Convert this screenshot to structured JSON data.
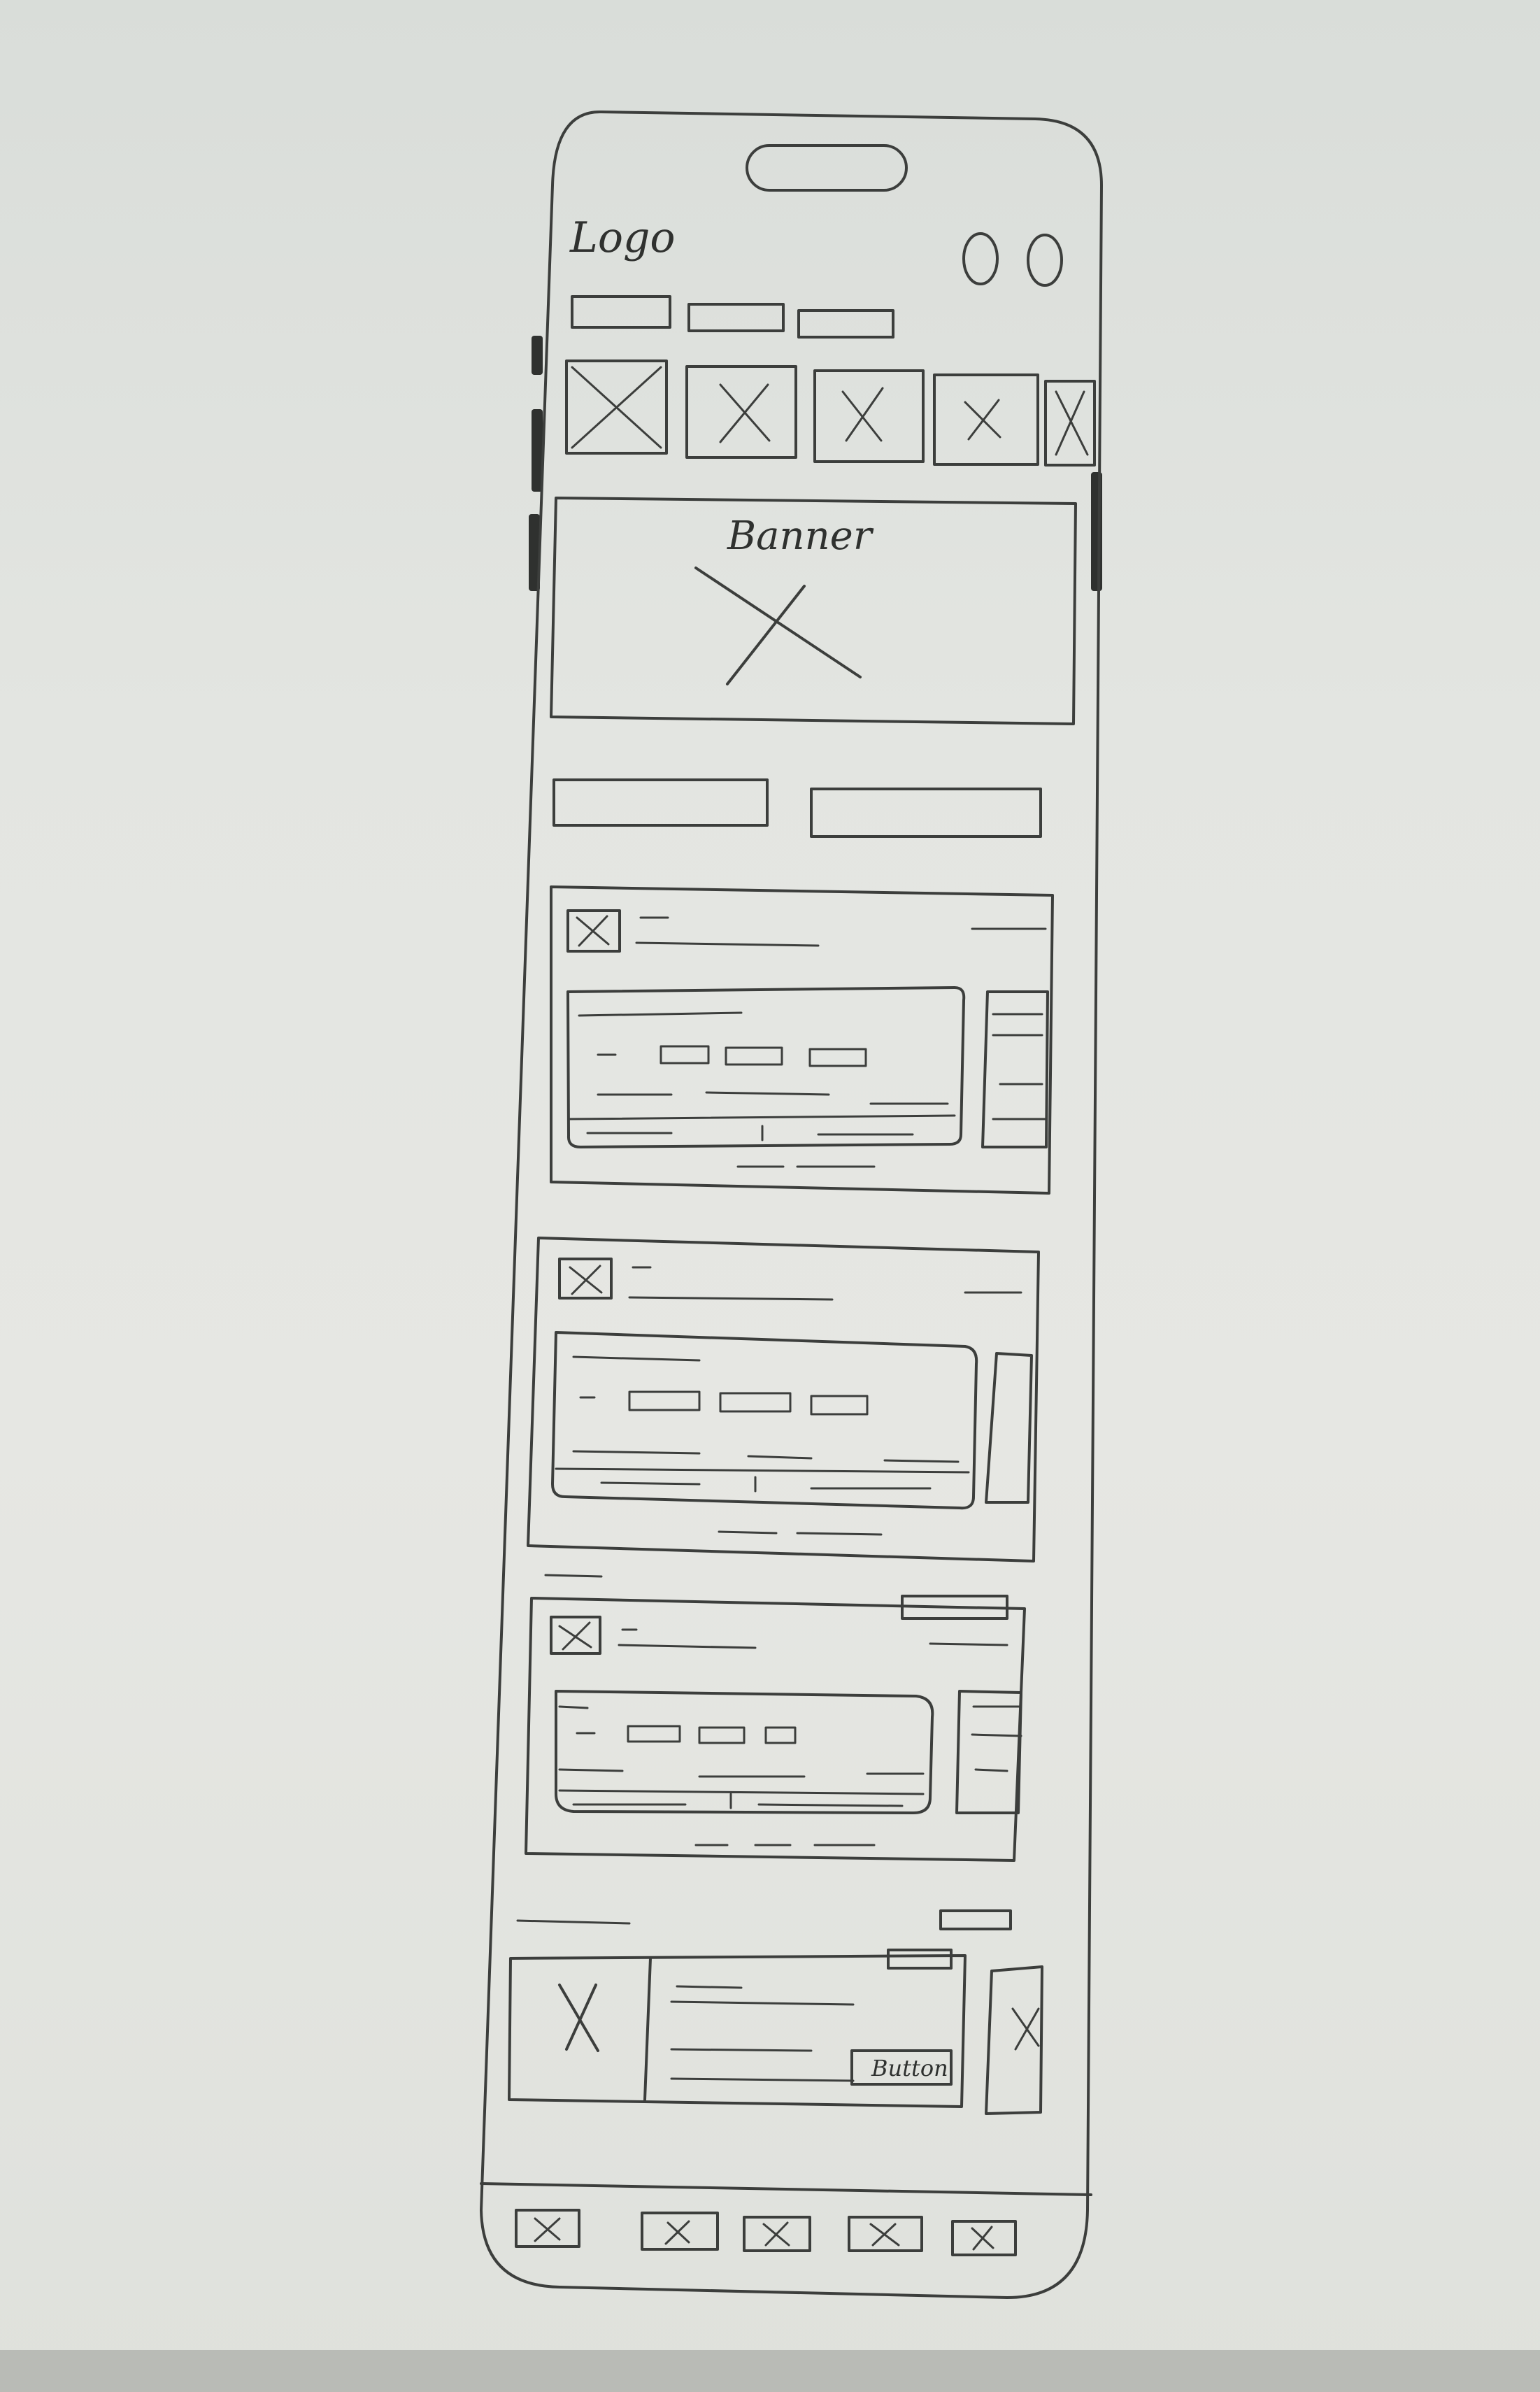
{
  "header": {
    "logo_text": "Logo",
    "icons": [
      "circle-icon",
      "circle-icon"
    ]
  },
  "top_tabs": [
    "",
    "",
    ""
  ],
  "category_tiles": [
    "image-placeholder-icon",
    "image-placeholder-icon",
    "image-placeholder-icon",
    "image-placeholder-icon",
    "image-placeholder-icon"
  ],
  "banner": {
    "label": "Banner"
  },
  "filter_buttons": [
    "",
    ""
  ],
  "cards": [
    {
      "id": "card-1"
    },
    {
      "id": "card-2"
    },
    {
      "id": "card-3"
    }
  ],
  "promo": {
    "button_label": "Button"
  },
  "bottom_nav": [
    "image-placeholder-icon",
    "image-placeholder-icon",
    "image-placeholder-icon",
    "image-placeholder-icon",
    "image-placeholder-icon"
  ],
  "colors": {
    "paper": "#e3e5e1",
    "ink": "#3c3e3c"
  }
}
